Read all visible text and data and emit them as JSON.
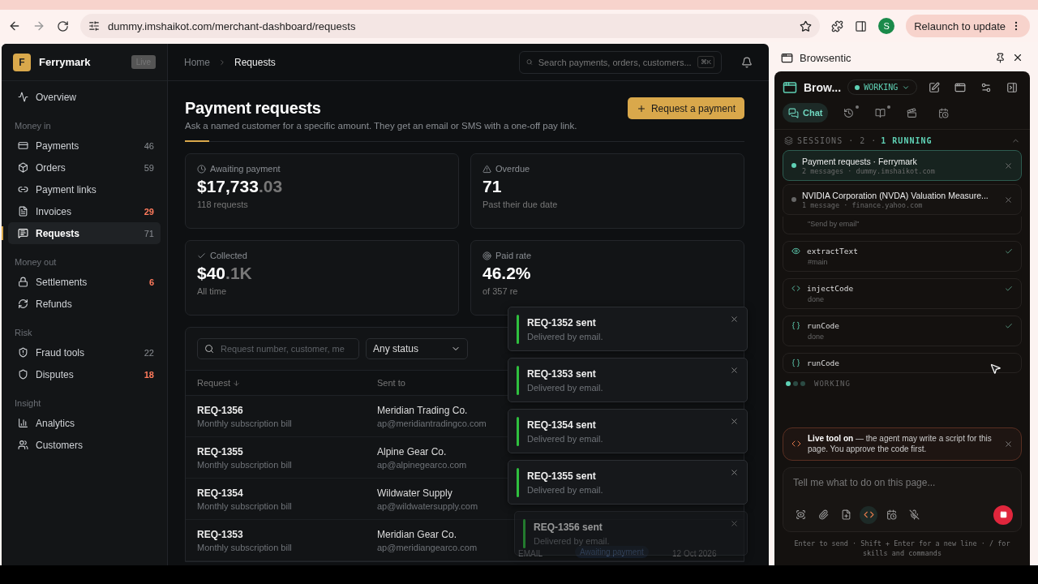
{
  "browser": {
    "url": "dummy.imshaikot.com/merchant-dashboard/requests",
    "profile_initial": "S",
    "relaunch_label": "Relaunch to update"
  },
  "brand": {
    "initial": "F",
    "name": "Ferrymark",
    "badge": "Live"
  },
  "nav": [
    {
      "kind": "item",
      "label": "Overview",
      "selected": false
    },
    {
      "kind": "section",
      "label": "Money in"
    },
    {
      "kind": "item",
      "label": "Payments",
      "count": "46",
      "alert": false,
      "selected": false
    },
    {
      "kind": "item",
      "label": "Orders",
      "count": "59",
      "alert": false,
      "selected": false
    },
    {
      "kind": "item",
      "label": "Payment links",
      "selected": false
    },
    {
      "kind": "item",
      "label": "Invoices",
      "count": "29",
      "alert": true,
      "selected": false
    },
    {
      "kind": "item",
      "label": "Requests",
      "count": "71",
      "alert": false,
      "selected": true
    },
    {
      "kind": "section",
      "label": "Money out"
    },
    {
      "kind": "item",
      "label": "Settlements",
      "count": "6",
      "alert": true,
      "selected": false
    },
    {
      "kind": "item",
      "label": "Refunds",
      "selected": false
    },
    {
      "kind": "section",
      "label": "Risk"
    },
    {
      "kind": "item",
      "label": "Fraud tools",
      "count": "22",
      "alert": false,
      "selected": false
    },
    {
      "kind": "item",
      "label": "Disputes",
      "count": "18",
      "alert": true,
      "selected": false
    },
    {
      "kind": "section",
      "label": "Insight"
    },
    {
      "kind": "item",
      "label": "Analytics",
      "selected": false
    },
    {
      "kind": "item",
      "label": "Customers",
      "selected": false
    }
  ],
  "breadcrumb": [
    "Home",
    "Requests"
  ],
  "search": {
    "placeholder": "Search payments, orders, customers...",
    "shortcut": "⌘K"
  },
  "page": {
    "title": "Payment requests",
    "subtitle": "Ask a named customer for a specific amount. They get an email or SMS with a one-off pay link.",
    "action": "Request a payment"
  },
  "stats": [
    {
      "kind": "clock",
      "label": "Awaiting payment",
      "value": "$17,733",
      "value_dim": ".03",
      "note": "118 requests"
    },
    {
      "kind": "warning",
      "label": "Overdue",
      "value": "71",
      "note": "Past their due date"
    },
    {
      "kind": "check",
      "label": "Collected",
      "value": "$40",
      "value_dim": ".1K",
      "note": "All time"
    },
    {
      "kind": "target",
      "label": "Paid rate",
      "value": "46.2%",
      "note": "of 357 re"
    }
  ],
  "filters": {
    "placeholder": "Request number, customer, me",
    "status": "Any status"
  },
  "table": {
    "columns": [
      "Request",
      "Sent to"
    ],
    "rows": [
      {
        "id": "REQ-1356",
        "description": "Monthly subscription bill",
        "name": "Meridian Trading Co.",
        "email": "ap@meridiantradingco.com"
      },
      {
        "id": "REQ-1355",
        "description": "Monthly subscription bill",
        "name": "Alpine Gear Co.",
        "email": "ap@alpinegearco.com"
      },
      {
        "id": "REQ-1354",
        "description": "Monthly subscription bill",
        "name": "Wildwater Supply",
        "email": "ap@wildwatersupply.com"
      },
      {
        "id": "REQ-1353",
        "description": "Monthly subscription bill",
        "name": "Meridian Gear Co.",
        "email": "ap@meridiangearco.com",
        "channel": "EMAIL",
        "status": "Awaiting payment",
        "date": "12 Oct 2026"
      }
    ]
  },
  "toasts": [
    {
      "title": "REQ-1352 sent",
      "message": "Delivered by email.",
      "faded": false
    },
    {
      "title": "REQ-1353 sent",
      "message": "Delivered by email.",
      "faded": false
    },
    {
      "title": "REQ-1354 sent",
      "message": "Delivered by email.",
      "faded": false
    },
    {
      "title": "REQ-1355 sent",
      "message": "Delivered by email.",
      "faded": false
    },
    {
      "title": "REQ-1356 sent",
      "message": "Delivered by email.",
      "faded": true
    }
  ],
  "panel": {
    "title": "Browsentic",
    "app_name": "Brow...",
    "status": "WORKING",
    "tabs": [
      {
        "label": "Chat",
        "selected": true,
        "dot": false
      },
      {
        "selected": false,
        "dot": true
      },
      {
        "selected": false,
        "dot": true
      },
      {
        "selected": false,
        "dot": false
      },
      {
        "selected": false,
        "dot": false
      }
    ],
    "sessions_label": "SESSIONS · 2 ·",
    "sessions_running": "1 RUNNING",
    "sessions": [
      {
        "title": "Payment requests · Ferrymark",
        "meta": "2 messages · dummy.imshaikot.com",
        "selected": true,
        "running": true
      },
      {
        "title": "NVIDIA Corporation (NVDA) Valuation Measure...",
        "meta": "1 message · finance.yahoo.com",
        "selected": false,
        "running": false
      }
    ],
    "steps": [
      {
        "kind": "fragment",
        "detail": "\"Send by email\""
      },
      {
        "kind": "extract",
        "tool": "extractText",
        "detail": "#main",
        "done": true
      },
      {
        "kind": "inject",
        "tool": "injectCode",
        "detail": "done",
        "done": true
      },
      {
        "kind": "run",
        "tool": "runCode",
        "detail": "done",
        "done": true
      },
      {
        "kind": "run",
        "tool": "runCode",
        "done": false
      }
    ],
    "working": "WORKING",
    "notice": "**Live tool on** — the agent may write a script for this page. You approve the code first.",
    "composer_placeholder": "Tell me what to do on this page...",
    "tools": [
      {
        "selected": false
      },
      {
        "selected": false
      },
      {
        "selected": false
      },
      {
        "selected": true
      },
      {
        "selected": false
      },
      {
        "selected": false
      }
    ],
    "hint": "Enter to send · Shift + Enter for a new line · / for skills and commands"
  }
}
